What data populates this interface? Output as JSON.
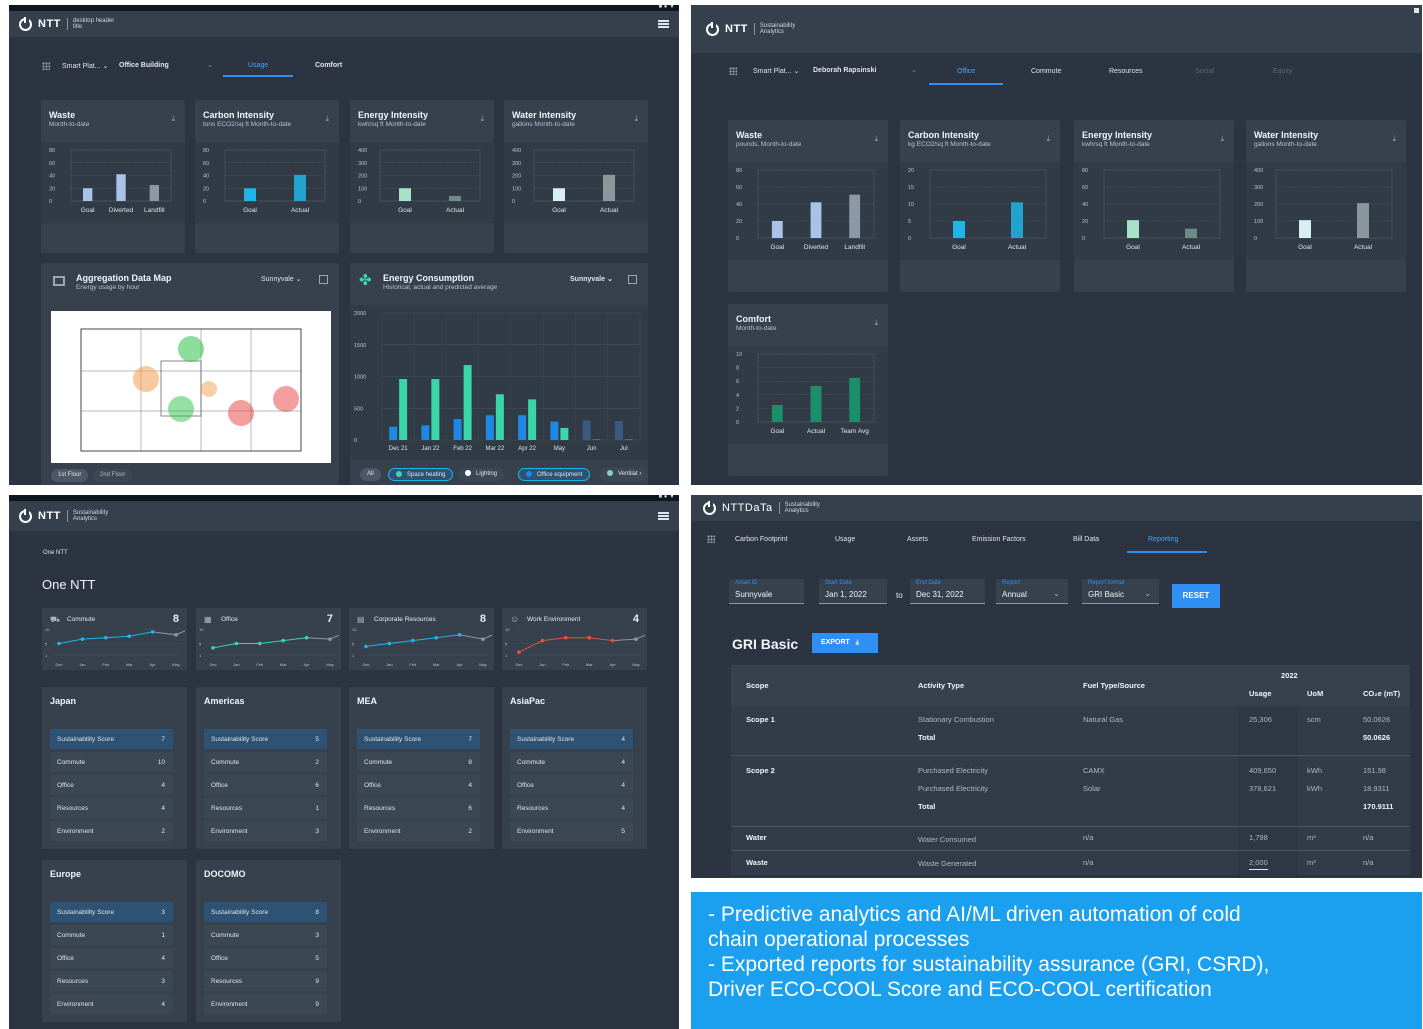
{
  "p1": {
    "logo": "NTT",
    "header_sub": "desktop header title",
    "window_controls": "■ ● ▼",
    "nav": {
      "crumb": "Smart Plat...",
      "building": "Office Building",
      "tabs": [
        "Usage",
        "Comfort"
      ]
    },
    "cards": [
      {
        "title": "Waste",
        "sub": "Month-to-date"
      },
      {
        "title": "Carbon Intensity",
        "sub": "tons ECO2/sq ft  Month-to-date"
      },
      {
        "title": "Energy Intensity",
        "sub": "kwh/sq ft  Month-to-date"
      },
      {
        "title": "Water Intensity",
        "sub": "gallons  Month-to-date"
      }
    ],
    "map": {
      "title": "Aggregation Data Map",
      "sub": "Energy usage by hour",
      "location": "Sunnyvale",
      "floors": [
        "1st Floor",
        "2nd Floor"
      ]
    },
    "energy": {
      "title": "Energy Consumption",
      "sub": "Historical, actual and predicted average",
      "location": "Sunnyvale",
      "chips": [
        "All",
        "Space heating",
        "Lighting",
        "Office equipment",
        "Ventilat"
      ]
    }
  },
  "p2": {
    "logo": "NTT",
    "header_sub": "Sustainability Analytics",
    "nav": {
      "crumb": "Smart Plat...",
      "person": "Deborah Rapsinski",
      "tabs": [
        "Office",
        "Commute",
        "Resources",
        "Social",
        "Equity"
      ]
    },
    "cards": [
      {
        "title": "Waste",
        "sub": "pounds, Month-to-date"
      },
      {
        "title": "Carbon Intensity",
        "sub": "kg ECO2/sq ft  Month-to-date"
      },
      {
        "title": "Energy Intensity",
        "sub": "kwh/sq ft  Month-to-date"
      },
      {
        "title": "Water Intensity",
        "sub": "gallons  Month-to-date"
      },
      {
        "title": "Comfort",
        "sub": "Month-to-date"
      }
    ]
  },
  "p3": {
    "logo": "NTT",
    "header_sub": "Sustainability Analytics",
    "window_controls": "■ ● ▼",
    "crumb": "One NTT",
    "title": "One NTT",
    "kpis": [
      {
        "label": "Commute",
        "value": "8"
      },
      {
        "label": "Office",
        "value": "7"
      },
      {
        "label": "Corporate Resources",
        "value": "8"
      },
      {
        "label": "Work Environment",
        "value": "4"
      }
    ],
    "regions": [
      {
        "name": "Japan",
        "rows": [
          [
            "Sustainability Score",
            "7"
          ],
          [
            "Commute",
            "10"
          ],
          [
            "Office",
            "4"
          ],
          [
            "Resources",
            "4"
          ],
          [
            "Environment",
            "2"
          ]
        ]
      },
      {
        "name": "Americas",
        "rows": [
          [
            "Sustainability Score",
            "5"
          ],
          [
            "Commute",
            "2"
          ],
          [
            "Office",
            "6"
          ],
          [
            "Resources",
            "1"
          ],
          [
            "Environment",
            "3"
          ]
        ]
      },
      {
        "name": "MEA",
        "rows": [
          [
            "Sustainability Score",
            "7"
          ],
          [
            "Commute",
            "8"
          ],
          [
            "Office",
            "4"
          ],
          [
            "Resources",
            "6"
          ],
          [
            "Environment",
            "2"
          ]
        ]
      },
      {
        "name": "AsiaPac",
        "rows": [
          [
            "Sustainability Score",
            "4"
          ],
          [
            "Commute",
            "4"
          ],
          [
            "Office",
            "4"
          ],
          [
            "Resources",
            "4"
          ],
          [
            "Environment",
            "5"
          ]
        ]
      },
      {
        "name": "Europe",
        "rows": [
          [
            "Sustainability Score",
            "3"
          ],
          [
            "Commute",
            "1"
          ],
          [
            "Office",
            "4"
          ],
          [
            "Resources",
            "3"
          ],
          [
            "Environment",
            "4"
          ]
        ]
      },
      {
        "name": "DOCOMO",
        "rows": [
          [
            "Sustainability Score",
            "8"
          ],
          [
            "Commute",
            "3"
          ],
          [
            "Office",
            "5"
          ],
          [
            "Resources",
            "9"
          ],
          [
            "Environment",
            "9"
          ]
        ]
      }
    ]
  },
  "p4": {
    "logo": "NTTDaTa",
    "header_sub": "Sustainability Analytics",
    "tabs": [
      "Carbon Footprint",
      "Usage",
      "Assets",
      "Emission Factors",
      "Bill Data",
      "Reporting"
    ],
    "filters": {
      "asset_label": "Asset ID",
      "asset": "Sunnyvale",
      "start_label": "Start Date",
      "start": "Jan 1, 2022",
      "to": "to",
      "end_label": "End Date",
      "end": "Dec 31, 2022",
      "report_label": "Report",
      "report": "Annual",
      "format_label": "Report format",
      "format": "GRI Basic",
      "reset": "RESET"
    },
    "title": "GRI Basic",
    "export": "EXPORT",
    "table": {
      "year": "2022",
      "headers": [
        "Scope",
        "Activity Type",
        "Fuel Type/Source",
        "Usage",
        "UoM",
        "CO₂e (mT)"
      ],
      "scope1": {
        "name": "Scope 1",
        "activity": "Stationary Combustion",
        "fuel": "Natural Gas",
        "usage": "25,306",
        "uom": "scm",
        "co2": "50.0626",
        "total_label": "Total",
        "total": "50.0626"
      },
      "scope2": {
        "name": "Scope 2",
        "rows": [
          [
            "Purchased Electricity",
            "CAMX",
            "409,650",
            "kWh",
            "151.98"
          ],
          [
            "Purchased Electricity",
            "Solar",
            "378,621",
            "kWh",
            "18.9311"
          ]
        ],
        "total_label": "Total",
        "total": "170.9111"
      },
      "water": {
        "name": "Water",
        "activity": "Water Consumed",
        "fuel": "n/a",
        "usage": "1,798",
        "uom": "m³",
        "co2": "n/a"
      },
      "waste": {
        "name": "Waste",
        "activity": "Waste Generated",
        "fuel": "n/a",
        "usage": "2,000",
        "uom": "m³",
        "co2": "n/a"
      }
    }
  },
  "banner": {
    "line1": "- Predictive analytics and AI/ML driven automation of cold",
    "line2": "chain operational processes",
    "line3": "- Exported reports for sustainability assurance (GRI, CSRD),",
    "line4": "Driver ECO-COOL Score and ECO-COOL certification"
  },
  "colors": {
    "accent": "#2f8ff3",
    "banner": "#1aa0ef",
    "teal": "#3ad6a8",
    "cyan": "#1fb5e8"
  },
  "chart_data": [
    {
      "type": "bar",
      "panel": "p1",
      "title": "Waste",
      "categories": [
        "Goal",
        "Diverted",
        "Landfill"
      ],
      "values": [
        20,
        42,
        25
      ],
      "ylim": [
        0,
        80
      ],
      "ticks": [
        0,
        20,
        40,
        60,
        80
      ]
    },
    {
      "type": "bar",
      "panel": "p1",
      "title": "Carbon Intensity",
      "categories": [
        "Goal",
        "Actual"
      ],
      "values": [
        20,
        41
      ],
      "ylim": [
        0,
        80
      ],
      "ticks": [
        0,
        20,
        40,
        60,
        80
      ]
    },
    {
      "type": "bar",
      "panel": "p1",
      "title": "Energy Intensity",
      "categories": [
        "Goal",
        "Actual"
      ],
      "values": [
        100,
        40
      ],
      "ylim": [
        0,
        400
      ],
      "ticks": [
        0,
        100,
        200,
        300,
        400
      ]
    },
    {
      "type": "bar",
      "panel": "p1",
      "title": "Water Intensity",
      "categories": [
        "Goal",
        "Actual"
      ],
      "values": [
        100,
        205
      ],
      "ylim": [
        0,
        400
      ],
      "ticks": [
        0,
        100,
        200,
        300,
        400
      ]
    },
    {
      "type": "bar",
      "panel": "p1",
      "title": "Energy Consumption",
      "categories": [
        "Dec 21",
        "Jan 22",
        "Feb 22",
        "Mar 22",
        "Apr 22",
        "May",
        "Jun",
        "Jul"
      ],
      "yticks": [
        0,
        500,
        1000,
        1500,
        2000
      ],
      "ylim": [
        0,
        2000
      ],
      "series": [
        {
          "name": "Office equipment",
          "values": [
            210,
            230,
            330,
            390,
            390,
            290,
            310,
            300
          ]
        },
        {
          "name": "Space heating",
          "values": [
            960,
            960,
            1180,
            720,
            640,
            190,
            null,
            null
          ]
        }
      ]
    },
    {
      "type": "bar",
      "panel": "p2",
      "title": "Waste",
      "categories": [
        "Goal",
        "Diverted",
        "Landfill"
      ],
      "values": [
        20,
        42,
        51
      ],
      "ylim": [
        0,
        80
      ],
      "ticks": [
        0,
        20,
        40,
        60,
        80
      ]
    },
    {
      "type": "bar",
      "panel": "p2",
      "title": "Carbon Intensity",
      "categories": [
        "Goal",
        "Actual"
      ],
      "values": [
        5,
        10.5
      ],
      "ylim": [
        0,
        20
      ],
      "ticks": [
        0,
        5,
        10,
        15,
        20
      ]
    },
    {
      "type": "bar",
      "panel": "p2",
      "title": "Energy Intensity",
      "categories": [
        "Goal",
        "Actual"
      ],
      "values": [
        21,
        11
      ],
      "ylim": [
        0,
        80
      ],
      "ticks": [
        0,
        20,
        40,
        60,
        80
      ]
    },
    {
      "type": "bar",
      "panel": "p2",
      "title": "Water Intensity",
      "categories": [
        "Goal",
        "Actual"
      ],
      "values": [
        105,
        205
      ],
      "ylim": [
        0,
        400
      ],
      "ticks": [
        0,
        100,
        200,
        300,
        400
      ]
    },
    {
      "type": "bar",
      "panel": "p2",
      "title": "Comfort",
      "categories": [
        "Goal",
        "Actual",
        "Team Avg"
      ],
      "values": [
        2.5,
        5.3,
        6.5
      ],
      "ylim": [
        0,
        10
      ],
      "ticks": [
        0,
        2,
        4,
        6,
        8,
        10
      ]
    },
    {
      "type": "line",
      "panel": "p3",
      "title": "Commute",
      "x": [
        "Dec",
        "Jan",
        "Feb",
        "Mar",
        "Apr",
        "May"
      ],
      "values": [
        5,
        6.5,
        7,
        7.5,
        9,
        8
      ],
      "ylim": [
        0,
        10
      ],
      "ticks": [
        1,
        5,
        10
      ]
    },
    {
      "type": "line",
      "panel": "p3",
      "title": "Office",
      "x": [
        "Dec",
        "Jan",
        "Feb",
        "Mar",
        "Apr",
        "May"
      ],
      "values": [
        3.5,
        5,
        5,
        6,
        7,
        6.5
      ],
      "ylim": [
        0,
        10
      ],
      "ticks": [
        1,
        5,
        10
      ]
    },
    {
      "type": "line",
      "panel": "p3",
      "title": "Corporate Resources",
      "x": [
        "Dec",
        "Jan",
        "Feb",
        "Mar",
        "Apr",
        "May"
      ],
      "values": [
        4,
        5,
        6,
        7,
        8,
        6.5
      ],
      "ylim": [
        0,
        10
      ],
      "ticks": [
        1,
        5,
        10
      ]
    },
    {
      "type": "line",
      "panel": "p3",
      "title": "Work Environment",
      "x": [
        "Dec",
        "Jan",
        "Feb",
        "Mar",
        "Apr",
        "May"
      ],
      "values": [
        2,
        6,
        7,
        7,
        6,
        6.5
      ],
      "ylim": [
        0,
        10
      ],
      "ticks": [
        1,
        5,
        10
      ]
    }
  ]
}
